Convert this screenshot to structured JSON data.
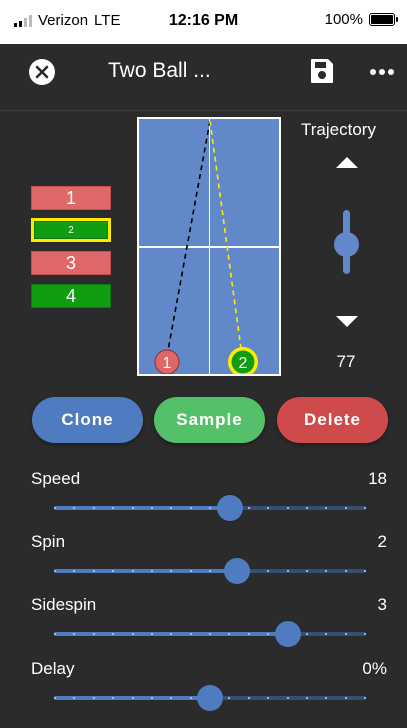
{
  "status_bar": {
    "carrier": "Verizon",
    "network": "LTE",
    "time": "12:16 PM",
    "battery": "100%"
  },
  "app_bar": {
    "title": "Two Ball ...",
    "close_icon": "close-circle-icon",
    "save_icon": "floppy-disk-icon",
    "more_icon": "more-horizontal-icon"
  },
  "balls": [
    {
      "label": "1",
      "color": "#e06767",
      "selected": false
    },
    {
      "label": "2",
      "color": "#119d11",
      "selected": true
    },
    {
      "label": "3",
      "color": "#e06767",
      "selected": false
    },
    {
      "label": "4",
      "color": "#119d11",
      "selected": false
    }
  ],
  "table": {
    "markers": [
      {
        "label": "1",
        "color": "#e06767"
      },
      {
        "label": "2",
        "color": "#119d11",
        "ring": "#ffeb00"
      }
    ],
    "colors": {
      "surface": "#6189c9",
      "line": "#ffffff",
      "path_1": "#000000",
      "path_2": "#ffeb00"
    }
  },
  "trajectory": {
    "label": "Trajectory",
    "value": "77"
  },
  "actions": {
    "clone": "Clone",
    "sample": "Sample",
    "delete": "Delete"
  },
  "sliders": [
    {
      "id": "speed",
      "label": "Speed",
      "value": "18",
      "fraction": 0.565
    },
    {
      "id": "spin",
      "label": "Spin",
      "value": "2",
      "fraction": 0.585
    },
    {
      "id": "sidespin",
      "label": "Sidespin",
      "value": "3",
      "fraction": 0.75
    },
    {
      "id": "delay",
      "label": "Delay",
      "value": "0%",
      "fraction": 0.5
    }
  ],
  "colors": {
    "accent": "#4f7bc1",
    "sample": "#55c06a",
    "delete": "#cf4b4b",
    "background": "#2b2b2b"
  }
}
